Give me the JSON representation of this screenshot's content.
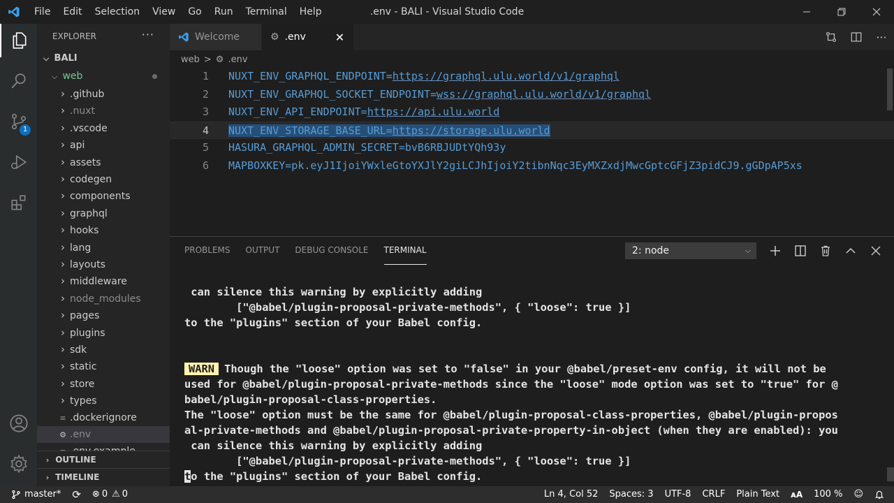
{
  "window": {
    "title": ".env - BALI - Visual Studio Code",
    "menu": [
      "File",
      "Edit",
      "Selection",
      "View",
      "Go",
      "Run",
      "Terminal",
      "Help"
    ]
  },
  "activity": {
    "scm_badge": "1"
  },
  "sidebar": {
    "title": "EXPLORER",
    "more": "···",
    "root": "BALI",
    "folder": "web",
    "items": [
      {
        "label": ".github",
        "type": "folder"
      },
      {
        "label": ".nuxt",
        "type": "folder",
        "dim": true
      },
      {
        "label": ".vscode",
        "type": "folder"
      },
      {
        "label": "api",
        "type": "folder"
      },
      {
        "label": "assets",
        "type": "folder"
      },
      {
        "label": "codegen",
        "type": "folder"
      },
      {
        "label": "components",
        "type": "folder"
      },
      {
        "label": "graphql",
        "type": "folder"
      },
      {
        "label": "hooks",
        "type": "folder"
      },
      {
        "label": "lang",
        "type": "folder"
      },
      {
        "label": "layouts",
        "type": "folder"
      },
      {
        "label": "middleware",
        "type": "folder"
      },
      {
        "label": "node_modules",
        "type": "folder",
        "dim": true
      },
      {
        "label": "pages",
        "type": "folder"
      },
      {
        "label": "plugins",
        "type": "folder"
      },
      {
        "label": "sdk",
        "type": "folder"
      },
      {
        "label": "static",
        "type": "folder"
      },
      {
        "label": "store",
        "type": "folder"
      },
      {
        "label": "types",
        "type": "folder"
      },
      {
        "label": ".dockerignore",
        "type": "file"
      },
      {
        "label": ".env",
        "type": "file-gear",
        "dim": true,
        "selected": true
      },
      {
        "label": ".env.example",
        "type": "file"
      }
    ],
    "outline": "OUTLINE",
    "timeline": "TIMELINE"
  },
  "tabs": [
    {
      "label": "Welcome",
      "active": false
    },
    {
      "label": ".env",
      "active": true
    }
  ],
  "breadcrumb": {
    "folder": "web",
    "sep": ">",
    "file": ".env"
  },
  "editor": {
    "lines": [
      {
        "n": "1",
        "key": "NUXT_ENV_GRAPHQL_ENDPOINT=",
        "url": "https://graphql.ulu.world/v1/graphql"
      },
      {
        "n": "2",
        "key": "NUXT_ENV_GRAPHQL_SOCKET_ENDPOINT=",
        "url": "wss://graphql.ulu.world/v1/graphql"
      },
      {
        "n": "3",
        "key": "NUXT_ENV_API_ENDPOINT=",
        "url": "https://api.ulu.world"
      },
      {
        "n": "4",
        "key": "NUXT_ENV_STORAGE_BASE_URL=",
        "url": "https://storage.ulu.world"
      },
      {
        "n": "5",
        "key": "HASURA_GRAPHQL_ADMIN_SECRET=bvB6RBJUDtYQh93y",
        "url": ""
      },
      {
        "n": "6",
        "key": "MAPBOXKEY=pk.eyJ1IjoiYWxleGtoYXJlY2giLCJhIjoiY2tibnNqc3EyMXZxdjMwcGptcGFjZ3pidCJ9.gGDpAP5xs",
        "url": ""
      }
    ]
  },
  "panel": {
    "tabs": [
      "PROBLEMS",
      "OUTPUT",
      "DEBUG CONSOLE",
      "TERMINAL"
    ],
    "terminal_select": "2: node",
    "terminal": {
      "l1": " can silence this warning by explicitly adding",
      "l2": "        [\"@babel/plugin-proposal-private-methods\", { \"loose\": true }]",
      "l3": "to the \"plugins\" section of your Babel config.",
      "warn_label": "WARN",
      "l4": "Though the \"loose\" option was set to \"false\" in your @babel/preset-env config, it will not be",
      "l5": "used for @babel/plugin-proposal-private-methods since the \"loose\" mode option was set to \"true\" for @",
      "l6": "babel/plugin-proposal-class-properties.",
      "l7": "The \"loose\" option must be the same for @babel/plugin-proposal-class-properties, @babel/plugin-propos",
      "l8": "al-private-methods and @babel/plugin-proposal-private-property-in-object (when they are enabled): you",
      "l9": " can silence this warning by explicitly adding",
      "l10": "        [\"@babel/plugin-proposal-private-methods\", { \"loose\": true }]",
      "l11_cursor": "t",
      "l11": "o the \"plugins\" section of your Babel config."
    }
  },
  "status": {
    "branch": "master*",
    "errors": "0",
    "warnings": "0",
    "position": "Ln 4, Col 52",
    "spaces": "Spaces: 3",
    "encoding": "UTF-8",
    "eol": "CRLF",
    "language": "Plain Text",
    "zoom": "100 %"
  },
  "colors": {
    "accent": "#0e70c0",
    "code": "#569cd6"
  }
}
